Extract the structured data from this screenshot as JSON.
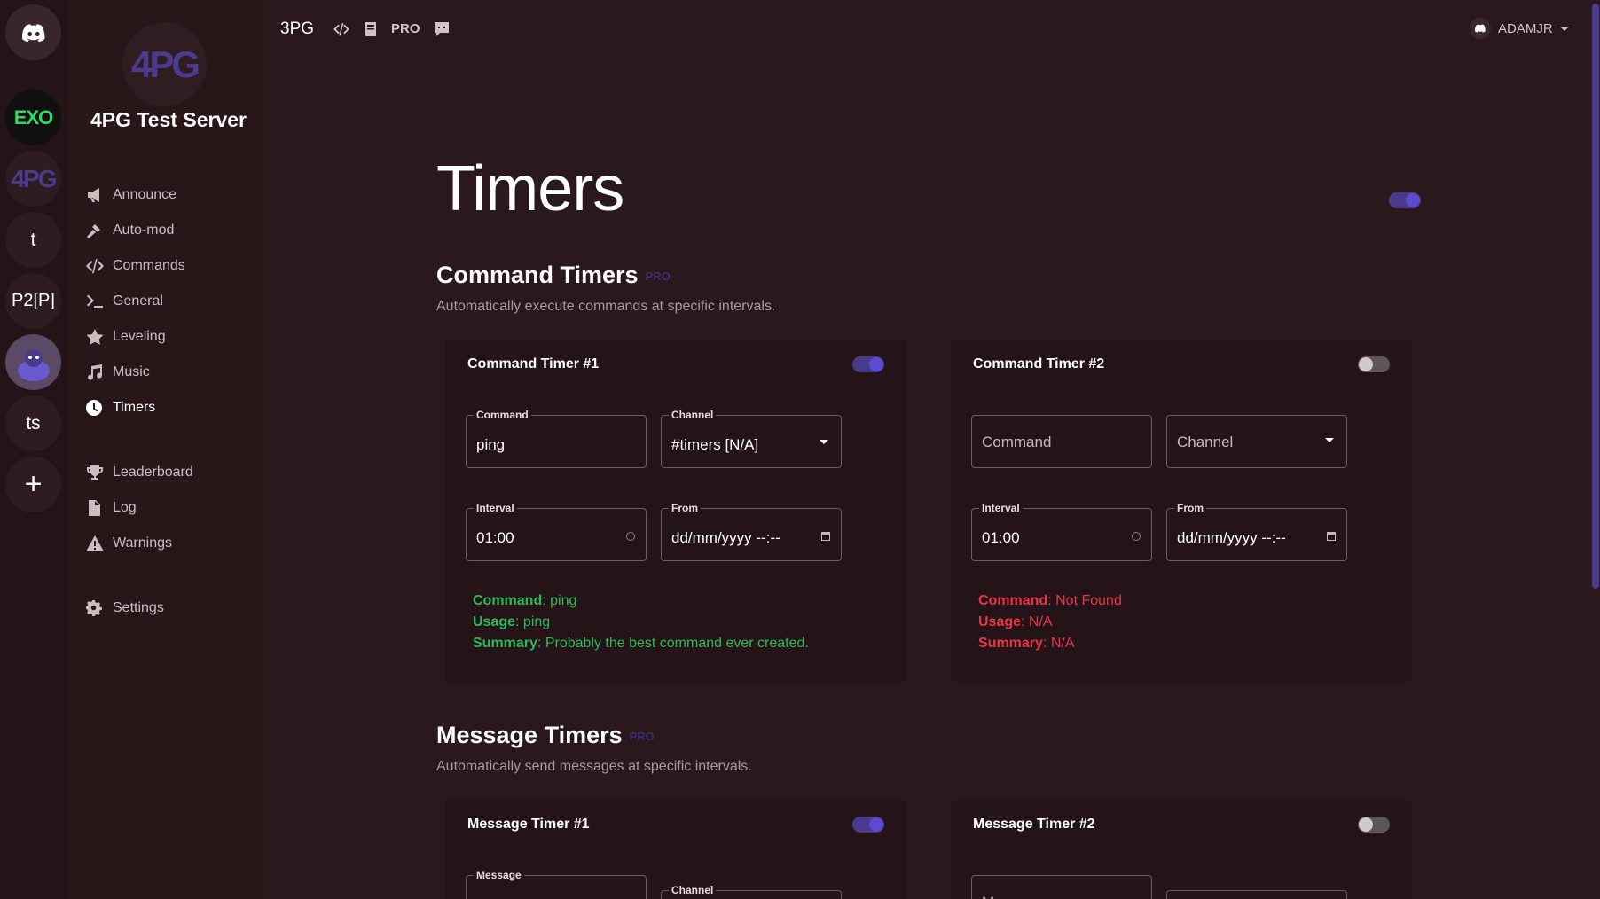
{
  "guilds": [
    {
      "label": "",
      "name": "discord"
    },
    {
      "label": "EXO",
      "name": "exo"
    },
    {
      "label": "4PG",
      "name": "4pg"
    },
    {
      "label": "t",
      "name": "t"
    },
    {
      "label": "P2[P]",
      "name": "p2p"
    },
    {
      "label": "",
      "name": "avatar"
    },
    {
      "label": "ts",
      "name": "ts"
    },
    {
      "label": "+",
      "name": "add"
    }
  ],
  "sidebar": {
    "server_logo": "4PG",
    "server_name": "4PG Test Server",
    "items": [
      {
        "label": "Announce",
        "icon": "megaphone-icon"
      },
      {
        "label": "Auto-mod",
        "icon": "hammer-icon"
      },
      {
        "label": "Commands",
        "icon": "code-icon"
      },
      {
        "label": "General",
        "icon": "terminal-icon"
      },
      {
        "label": "Leveling",
        "icon": "star-icon"
      },
      {
        "label": "Music",
        "icon": "music-icon"
      },
      {
        "label": "Timers",
        "icon": "clock-icon",
        "active": true
      },
      {
        "label": "Leaderboard",
        "icon": "trophy-icon"
      },
      {
        "label": "Log",
        "icon": "file-icon"
      },
      {
        "label": "Warnings",
        "icon": "warning-icon"
      },
      {
        "label": "Settings",
        "icon": "gear-icon"
      }
    ]
  },
  "topbar": {
    "brand": "3PG",
    "pro": "PRO",
    "user": "ADAMJR"
  },
  "page": {
    "title": "Timers",
    "enabled": true
  },
  "command_timers": {
    "title": "Command Timers",
    "badge": "PRO",
    "description": "Automatically execute commands at specific intervals.",
    "timers": [
      {
        "title": "Command Timer #1",
        "enabled": true,
        "command_label": "Command",
        "command_value": "ping",
        "channel_label": "Channel",
        "channel_value": "#timers [N/A]",
        "interval_label": "Interval",
        "interval_value": "01:00",
        "from_label": "From",
        "from_value": "dd/mm/yyyy --:--",
        "info_command_key": "Command",
        "info_command_val": ": ping",
        "info_usage_key": "Usage",
        "info_usage_val": ": ping",
        "info_summary_key": "Summary",
        "info_summary_val": ": Probably the best command ever created.",
        "status_color": "#2eb85c"
      },
      {
        "title": "Command Timer #2",
        "enabled": false,
        "command_placeholder": "Command",
        "channel_placeholder": "Channel",
        "interval_label": "Interval",
        "interval_value": "01:00",
        "from_label": "From",
        "from_value": "dd/mm/yyyy --:--",
        "info_command_key": "Command",
        "info_command_val": ": Not Found",
        "info_usage_key": "Usage",
        "info_usage_val": ": N/A",
        "info_summary_key": "Summary",
        "info_summary_val": ": N/A",
        "status_color": "#e6344a"
      }
    ]
  },
  "message_timers": {
    "title": "Message Timers",
    "badge": "PRO",
    "description": "Automatically send messages at specific intervals.",
    "timers": [
      {
        "title": "Message Timer #1",
        "enabled": true,
        "message_label": "Message",
        "channel_label": "Channel"
      },
      {
        "title": "Message Timer #2",
        "enabled": false,
        "message_placeholder": "M"
      }
    ]
  },
  "colors": {
    "accent": "#4a3a8c",
    "background": "#2b181c",
    "card": "#241417",
    "success": "#2eb85c",
    "danger": "#e6344a"
  }
}
